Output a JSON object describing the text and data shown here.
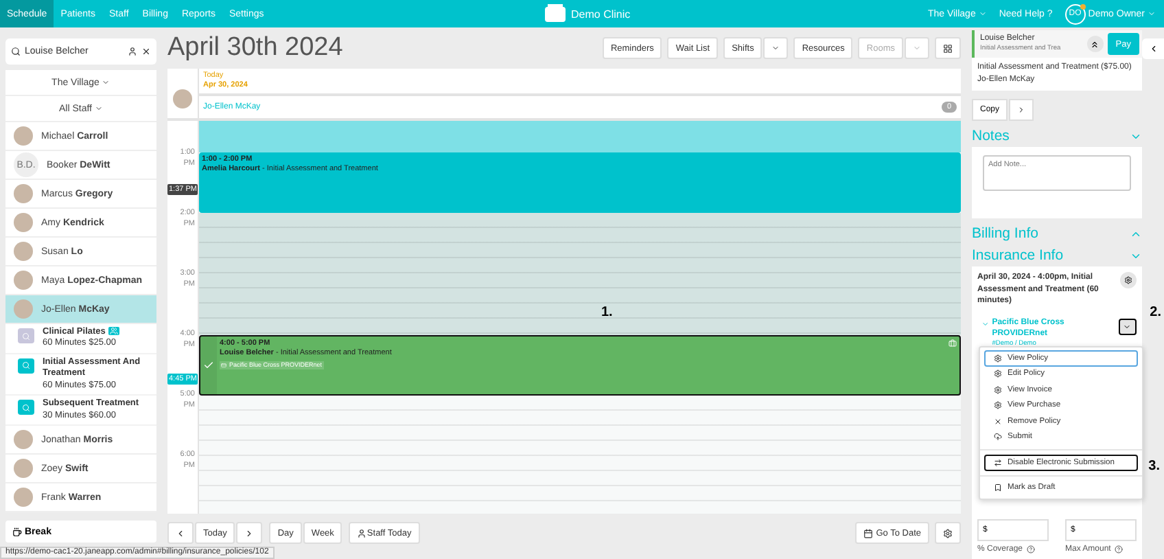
{
  "nav": {
    "tabs": [
      {
        "label": "Schedule",
        "selected": true
      },
      {
        "label": "Patients",
        "selected": false
      },
      {
        "label": "Staff",
        "selected": false
      },
      {
        "label": "Billing",
        "selected": false
      },
      {
        "label": "Reports",
        "selected": false
      },
      {
        "label": "Settings",
        "selected": false
      }
    ],
    "clinic": "Demo Clinic",
    "location": "The Village",
    "help": "Need Help ?",
    "user_initials": "DO",
    "user": "Demo Owner",
    "notification": true
  },
  "search": {
    "value": "Louise Belcher"
  },
  "staff_panel": {
    "location": "The Village",
    "filter": "All Staff",
    "staff": [
      {
        "name": "Michael **Carroll**",
        "selected": false
      },
      {
        "name": "Booker **DeWitt**",
        "initials": "B.D.",
        "selected": false
      },
      {
        "name": "Marcus **Gregory**",
        "selected": false
      },
      {
        "name": "Amy **Kendrick**",
        "selected": false
      },
      {
        "name": "Susan **Lo**",
        "selected": false
      },
      {
        "name": "Maya **Lopez-Chapman**",
        "selected": false
      },
      {
        "name": "Jo-Ellen **McKay**",
        "selected": true,
        "services": [
          {
            "name": "Clinical Pilates",
            "details": "60 Minutes $25.00",
            "kind": "group"
          },
          {
            "name": "Initial Assessment And Treatment",
            "details": "60 Minutes $75.00",
            "kind": "single"
          },
          {
            "name": "Subsequent Treatment",
            "details": "30 Minutes $60.00",
            "kind": "single"
          }
        ]
      },
      {
        "name": "Jonathan **Morris**",
        "selected": false
      },
      {
        "name": "Zoey **Swift**",
        "selected": false
      },
      {
        "name": "Frank **Warren**",
        "selected": false
      }
    ]
  },
  "break_button": "Break",
  "title": "April 30th 2024",
  "toolbar": [
    {
      "label": "Reminders",
      "kind": "button",
      "disabled": false
    },
    {
      "label": "Wait List",
      "kind": "button",
      "disabled": false
    },
    {
      "label": "Shifts",
      "kind": "split",
      "disabled": false
    },
    {
      "label": "Resources",
      "kind": "button",
      "disabled": false
    },
    {
      "label": "Rooms",
      "kind": "split",
      "disabled": true
    },
    {
      "kind": "grid",
      "disabled": false
    }
  ],
  "calendar": {
    "today_label": "Today",
    "date": "Apr 30, 2024",
    "staff": "Jo-Ellen McKay",
    "count": "0",
    "annotation": "1.",
    "hours": [
      {
        "time": "1:00",
        "period": "PM"
      },
      {
        "time": "2:00",
        "period": "PM"
      },
      {
        "time": "3:00",
        "period": "PM"
      },
      {
        "time": "4:00",
        "period": "PM"
      },
      {
        "time": "5:00",
        "period": "PM"
      },
      {
        "time": "6:00",
        "period": "PM"
      }
    ],
    "markers": [
      {
        "label": "1:37 PM",
        "kind": "now"
      },
      {
        "label": "4:45 PM",
        "kind": "cursor"
      }
    ],
    "blocks": [
      {
        "kind": "available"
      },
      {
        "kind": "appointment",
        "time": "1:00 - 2:00 PM",
        "patient": "Amelia Harcourt",
        "service": "- Initial Assessment and Treatment",
        "arrived": false,
        "selected": false
      },
      {
        "kind": "unavailable"
      },
      {
        "kind": "appointment",
        "time": "4:00 - 5:00 PM",
        "patient": "Louise Belcher",
        "service": "- Initial Assessment and Treatment",
        "insurance": "Pacific Blue Cross PROVIDERnet",
        "arrived": true,
        "selected": true
      },
      {
        "kind": "open"
      }
    ]
  },
  "bottom_nav": {
    "today": "Today",
    "views": [
      {
        "label": "Day"
      },
      {
        "label": "Week"
      }
    ],
    "staff_today": "Staff Today",
    "go_to_date": "Go To Date"
  },
  "appointment_panel": {
    "patient": "Louise Belcher",
    "service_short": "Initial Assessment and Trea",
    "pay": "Pay",
    "service": "Initial Assessment and Treatment ($75.00)",
    "provider": "Jo-Ellen McKay",
    "copy": "Copy",
    "notes": {
      "title": "Notes",
      "placeholder": "Add Note...",
      "expanded": true
    },
    "billing": {
      "title": "Billing Info",
      "expanded": false
    },
    "insurance": {
      "title": "Insurance Info",
      "expanded": true,
      "appointment": "April 30, 2024 - 4:00pm, Initial Assessment and Treatment (60 minutes)",
      "annotation": "2.",
      "policy": {
        "name": "Pacific Blue Cross PROVIDERnet",
        "account": "#Demo / Demo",
        "expanded": true
      },
      "menu": {
        "annotation": "3.",
        "groups": [
          [
            {
              "label": "View Policy",
              "kind": "gear",
              "selected": true,
              "outlined": false
            },
            {
              "label": "Edit Policy",
              "kind": "gear",
              "selected": false,
              "outlined": false
            },
            {
              "label": "View Invoice",
              "kind": "gear",
              "selected": false,
              "outlined": false
            },
            {
              "label": "View Purchase",
              "kind": "gear",
              "selected": false,
              "outlined": false
            },
            {
              "label": "Remove Policy",
              "kind": "remove",
              "selected": false,
              "outlined": false
            },
            {
              "label": "Submit",
              "kind": "upload",
              "selected": false,
              "outlined": false
            }
          ],
          [
            {
              "label": "Disable Electronic Submission",
              "kind": "toggle",
              "selected": false,
              "outlined": true
            }
          ],
          [
            {
              "label": "Mark as Draft",
              "kind": "bookmark",
              "selected": false,
              "outlined": false
            }
          ]
        ]
      },
      "fields": [
        {
          "prefix": "$"
        },
        {
          "prefix": "$"
        }
      ],
      "labels": [
        "% Coverage",
        "Max Amount"
      ]
    }
  },
  "status_url": "https://demo-cac1-20.janeapp.com/admin#billing/insurance_policies/102"
}
